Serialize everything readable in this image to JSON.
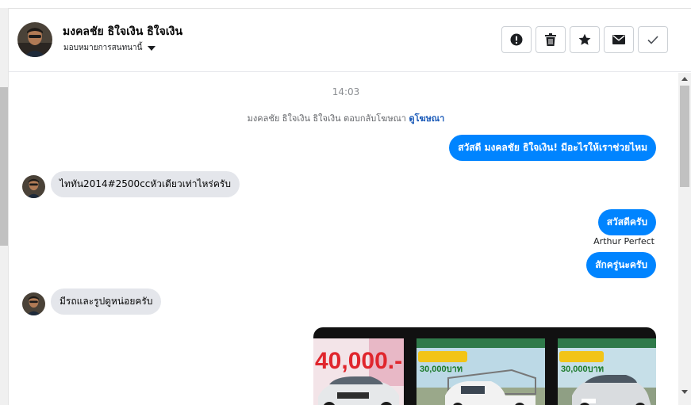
{
  "header": {
    "contact_name": "มงคลชัย ธิใจเงิน ธิใจเงิน",
    "assign_label": "มอบหมายการสนทนานี้"
  },
  "actions": [
    {
      "icon": "alert-icon",
      "name": "mark-spam-button"
    },
    {
      "icon": "trash-icon",
      "name": "delete-button"
    },
    {
      "icon": "star-icon",
      "name": "star-button"
    },
    {
      "icon": "envelope-icon",
      "name": "mark-unread-button"
    },
    {
      "icon": "check-icon",
      "name": "mark-done-button"
    }
  ],
  "chat": {
    "timestamp": "14:03",
    "ad_reply_text": "มงคลชัย ธิใจเงิน ธิใจเงิน ตอบกลับโฆษณา",
    "ad_reply_link": "ดูโฆษณา",
    "messages": [
      {
        "direction": "out",
        "text": "สวัสดี มงคลชัย ธิใจเงิน! มีอะไรให้เราช่วยไหม"
      },
      {
        "direction": "in",
        "text": "ไททัน2014#2500ccหัวเดียวเท่าไหร่ครับ"
      },
      {
        "direction": "out",
        "text": "สวัสดีครับ"
      },
      {
        "direction": "out",
        "text": "สักครู่นะครับ",
        "sender": "Arthur Perfect"
      },
      {
        "direction": "in",
        "text": "มีรถและรูปดูหน่อยครับ"
      }
    ],
    "image_card": {
      "thumb_1_text": "40,000.-",
      "thumb_2_text": "30,000บาท",
      "thumb_3_text": "30,000บาท"
    }
  },
  "colors": {
    "outgoing_bubble": "#0084ff",
    "incoming_bubble": "#e4e6eb",
    "link": "#1a5ab8"
  }
}
